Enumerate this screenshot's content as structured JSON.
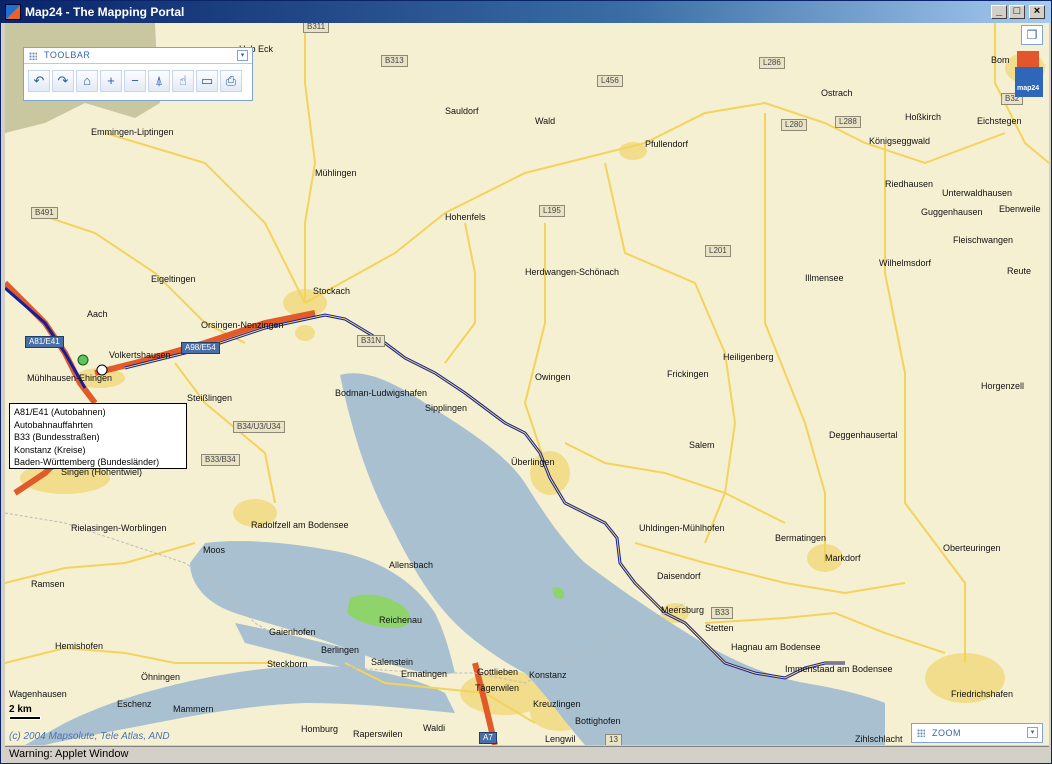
{
  "window": {
    "title": "Map24 - The Mapping Portal",
    "minimize_glyph": "_",
    "maximize_glyph": "□",
    "close_glyph": "×"
  },
  "toolbar": {
    "title": "TOOLBAR",
    "collapse_glyph": "▾",
    "tools": [
      {
        "name": "back-icon",
        "glyph": "↶"
      },
      {
        "name": "forward-icon",
        "glyph": "↷"
      },
      {
        "name": "home-icon",
        "glyph": "⌂"
      },
      {
        "name": "zoom-in-icon",
        "glyph": "+"
      },
      {
        "name": "zoom-out-icon",
        "glyph": "−"
      },
      {
        "name": "location-pin-icon",
        "glyph": "⍋"
      },
      {
        "name": "pan-hand-icon",
        "glyph": "☝"
      },
      {
        "name": "measure-ruler-icon",
        "glyph": "▭"
      },
      {
        "name": "print-icon",
        "glyph": "⎙"
      }
    ]
  },
  "view_switch_glyph": "❐",
  "logo_text": "map24",
  "legend_popup": {
    "lines": [
      "A81/E41 (Autobahnen)",
      "Autobahnauffahrten",
      "B33 (Bundesstraßen)",
      "Konstanz (Kreise)",
      "Baden-Württemberg (Bundesländer)"
    ]
  },
  "scale": {
    "label": "2 km"
  },
  "copyright": "(c) 2004 Mapsolute, Tele Atlas, AND",
  "zoom_panel": {
    "title": "ZOOM",
    "collapse_glyph": "▾"
  },
  "status": "Warning: Applet Window",
  "colors": {
    "water": "#a8c0d0",
    "land": "#f6f0d2",
    "forest": "#c9c79f",
    "park": "#8fd36b",
    "route": "#1020a0",
    "motorway": "#e05a2a",
    "road": "#f3d35c",
    "urban": "#f2dd8c"
  },
  "map": {
    "towns": [
      "Emmingen-Liptingen",
      "Sauldorf",
      "Wald",
      "Pfullendorf",
      "Ostrach",
      "Hoßkirch",
      "Eichstegen",
      "Königseggwald",
      "Mühlingen",
      "Hohenfels",
      "Riedhausen",
      "Unterwaldhausen",
      "Guggenhausen",
      "Ebenweile",
      "Fleischwangen",
      "Herdwangen-Schönach",
      "Illmensee",
      "Wilhelmsdorf",
      "Reute",
      "Eigeltingen",
      "Stockach",
      "Aach",
      "Orsingen-Nenzingen",
      "Volkertshausen",
      "Mühlhausen-Ehingen",
      "Heiligenberg",
      "Owingen",
      "Frickingen",
      "Horgenzell",
      "Bodman-Ludwigshafen",
      "Sipplingen",
      "Steißlingen",
      "Deggenhausertal",
      "Salem",
      "Überlingen",
      "Singen (Hohentwiel)",
      "Rielasingen-Worblingen",
      "Radolfzell am Bodensee",
      "Uhldingen-Mühlhofen",
      "Bermatingen",
      "Oberteuringen",
      "Moos",
      "Markdorf",
      "Allensbach",
      "Daisendorf",
      "Ramsen",
      "Meersburg",
      "Reichenau",
      "Stetten",
      "Gaienhofen",
      "Hemishofen",
      "Hagnau am Bodensee",
      "Berlingen",
      "Steckborn",
      "Salenstein",
      "Öhningen",
      "Gottlieben",
      "Tägerwilen",
      "Konstanz",
      "Immenstaad am Bodensee",
      "Ermatingen",
      "Friedrichshafen",
      "Wagenhausen",
      "Eschenz",
      "Mammern",
      "Kreuzlingen",
      "Bottighofen",
      "Homburg",
      "Raperswilen",
      "Waldi",
      "Lengwil",
      "Zihlschlacht",
      "Bom",
      "Hob Eck"
    ],
    "roads": [
      "B311",
      "B313",
      "L456",
      "L286",
      "B32",
      "L280",
      "L288",
      "B491",
      "L195",
      "L201",
      "A81/E41",
      "A98/E54",
      "B31N",
      "B34/U3/U34",
      "B33/B34",
      "B33",
      "A7",
      "13"
    ]
  }
}
